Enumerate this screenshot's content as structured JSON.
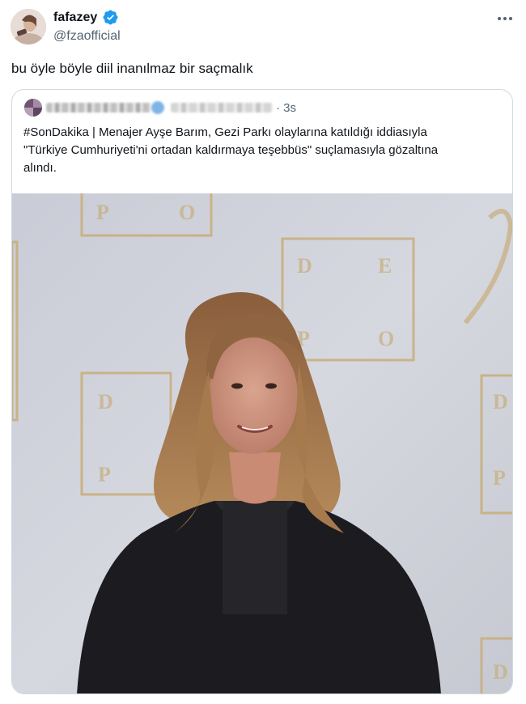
{
  "author": {
    "name": "fafazey",
    "handle": "@fzaofficial",
    "verified": true,
    "avatar_icon": "profile-photo"
  },
  "more_icon": "more-horizontal-icon",
  "tweet": {
    "text": "bu öyle böyle diil inanılmaz bir saçmalık"
  },
  "quoted": {
    "account_obscured": true,
    "time": "3s",
    "text_lines": [
      "#SonDakika | Menajer Ayşe Barım, Gezi Parkı olaylarına katıldığı iddiasıyla",
      "\"Türkiye Cumhuriyeti'ni ortadan kaldırmaya teşebbüs\" suçlamasıyla gözaltına",
      "alındı."
    ],
    "photo_alt": "woman-portrait-photo"
  },
  "colors": {
    "text": "#0f1419",
    "secondary": "#536471",
    "border": "#cfd9de",
    "verified": "#1d9bf0"
  }
}
